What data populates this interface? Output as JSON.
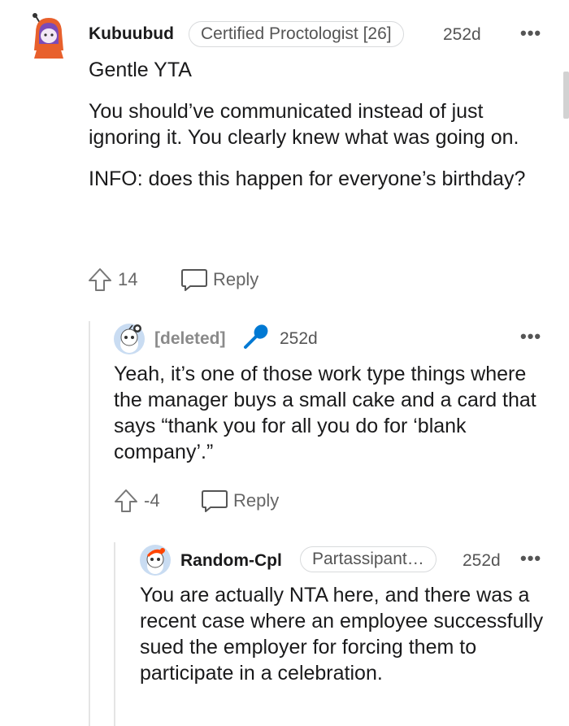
{
  "comments": [
    {
      "username": "Kubuubud",
      "flair": "Certified Proctologist [26]",
      "age": "252d",
      "more": "•••",
      "paragraphs": [
        "Gentle YTA",
        "You should’ve communicated instead of just ignoring it. You clearly knew what was going on.",
        "INFO: does this happen for everyone’s birthday?"
      ],
      "votes": "14",
      "reply_label": "Reply"
    },
    {
      "username": "[deleted]",
      "age": "252d",
      "more": "•••",
      "paragraphs": [
        "Yeah, it’s one of those work type things where the manager buys a small cake and a card that says “thank you for all you do for ‘blank company’.”"
      ],
      "votes": "-4",
      "reply_label": "Reply"
    },
    {
      "username": "Random-Cpl",
      "flair": "Partassipant…",
      "age": "252d",
      "more": "•••",
      "paragraphs": [
        "You are actually NTA here, and there was a recent case where an employee successfully sued the employer for forcing them to participate in a celebration."
      ]
    }
  ],
  "colors": {
    "text": "#1a1a1b",
    "muted": "#555555",
    "mic_blue": "#0079d3",
    "avatar_orange": "#ff4500"
  }
}
